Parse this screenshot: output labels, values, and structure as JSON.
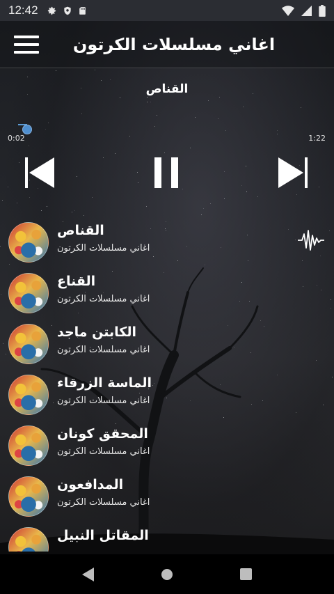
{
  "status_bar": {
    "time": "12:42",
    "left_icons": [
      "gear-icon",
      "shield-icon",
      "sd-card-icon"
    ],
    "right_icons": [
      "wifi-icon",
      "signal-icon",
      "battery-icon"
    ]
  },
  "app_bar": {
    "title": "اغاني مسلسلات الكرتون",
    "menu_icon": "hamburger-menu-icon"
  },
  "player": {
    "now_playing_title": "القناص",
    "current_time": "0:02",
    "duration": "1:22",
    "progress_fraction": 0.03,
    "accent_color": "#4f8fcf",
    "controls": [
      "skip-previous-icon",
      "pause-icon",
      "skip-next-icon"
    ]
  },
  "tracks": [
    {
      "title": "القناص",
      "subtitle": "اغاني مسلسلات الكرتون",
      "playing": true
    },
    {
      "title": "القناع",
      "subtitle": "اغاني مسلسلات الكرتون",
      "playing": false
    },
    {
      "title": "الكابتن  ماجد",
      "subtitle": "اغاني مسلسلات الكرتون",
      "playing": false
    },
    {
      "title": "الماسة  الزرقاء",
      "subtitle": "اغاني مسلسلات الكرتون",
      "playing": false
    },
    {
      "title": "المحقق  كونان",
      "subtitle": "اغاني مسلسلات الكرتون",
      "playing": false
    },
    {
      "title": "المدافعون",
      "subtitle": "اغاني مسلسلات الكرتون",
      "playing": false
    },
    {
      "title": "المقاتل  النبيل",
      "subtitle": "",
      "playing": false
    }
  ],
  "nav_bar": {
    "buttons": [
      "back-triangle-icon",
      "home-circle-icon",
      "recents-square-icon"
    ]
  }
}
